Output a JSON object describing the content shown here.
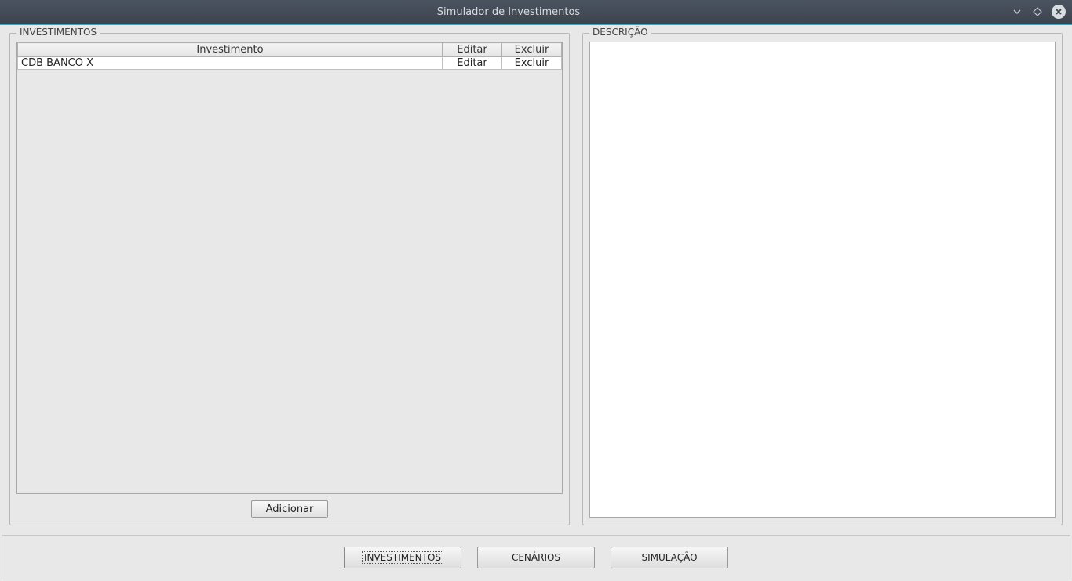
{
  "window": {
    "title": "Simulador de Investimentos"
  },
  "panels": {
    "investments_legend": "INVESTIMENTOS",
    "description_legend": "DESCRIÇÃO"
  },
  "table": {
    "headers": {
      "name": "Investimento",
      "edit": "Editar",
      "delete": "Excluir"
    },
    "rows": [
      {
        "name": "CDB BANCO X",
        "edit": "Editar",
        "delete": "Excluir"
      }
    ]
  },
  "buttons": {
    "add": "Adicionar"
  },
  "nav": {
    "investments": "INVESTIMENTOS",
    "scenarios": "CENÁRIOS",
    "simulation": "SIMULAÇÃO"
  }
}
